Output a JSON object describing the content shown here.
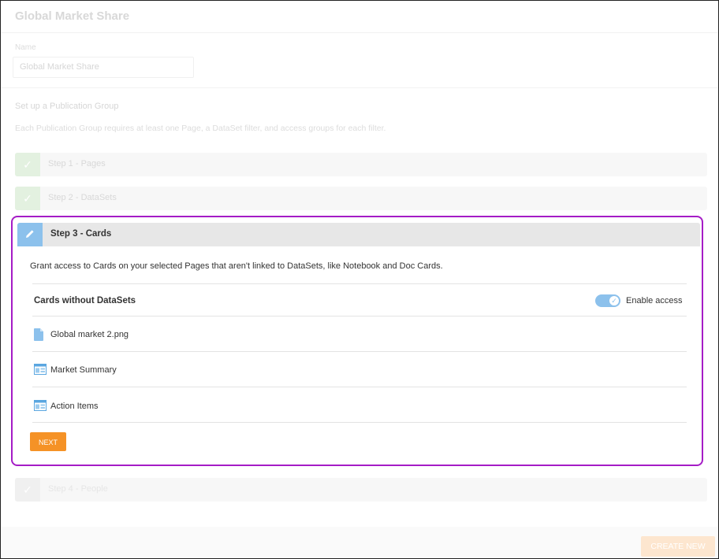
{
  "header": {
    "title": "Global Market Share"
  },
  "name_field": {
    "label": "Name",
    "value": "Global Market Share"
  },
  "setup": {
    "title": "Set up a Publication Group",
    "description": "Each Publication Group requires at least one Page, a DataSet filter, and access groups for each filter."
  },
  "steps": [
    {
      "label": "Step 1 - Pages",
      "status": "complete"
    },
    {
      "label": "Step 2 - DataSets",
      "status": "complete"
    },
    {
      "label": "Step 3 - Cards",
      "status": "active"
    },
    {
      "label": "Step 4 - People",
      "status": "pending"
    }
  ],
  "step3": {
    "description": "Grant access to Cards on your selected Pages that aren't linked to DataSets, like Notebook and Doc Cards.",
    "section_title": "Cards without DataSets",
    "toggle": {
      "label": "Enable access",
      "on": true
    },
    "items": [
      {
        "label": "Global market 2.png",
        "icon": "file-icon"
      },
      {
        "label": "Market Summary",
        "icon": "card-icon"
      },
      {
        "label": "Action Items",
        "icon": "card-icon"
      }
    ],
    "next_label": "NEXT"
  },
  "footer": {
    "create_label": "CREATE NEW"
  },
  "colors": {
    "accent_blue": "#8cc1ec",
    "highlight": "#a51cc6",
    "next_button": "#f59226",
    "complete_green": "#e3f1e0"
  }
}
